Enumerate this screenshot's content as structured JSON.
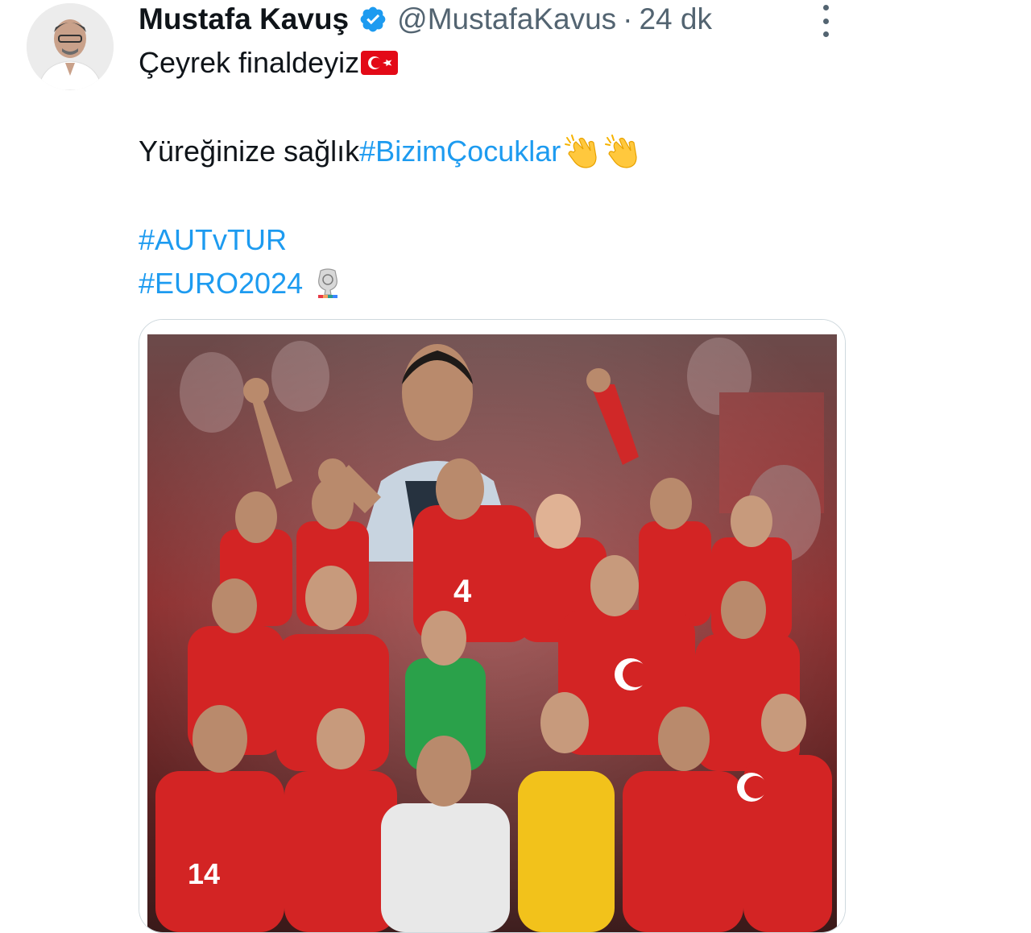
{
  "tweet": {
    "author": {
      "name": "Mustafa Kavuş",
      "handle": "@MustafaKavus",
      "verified": true,
      "avatar": "avatar-photo"
    },
    "separator": "·",
    "time": "24 dk",
    "more_icon": "more-dots-icon",
    "text": {
      "line1": "Çeyrek finaldeyiz",
      "line1_emoji": "turkey-flag-emoji",
      "line2_text": "Yüreğinize sağlık ",
      "line2_hashtag": "#BizimÇocuklar",
      "line2_emoji": "clapping-hands-emoji",
      "line3_hashtag": "#AUTvTUR",
      "line4_hashtag": "#EURO2024",
      "line4_emoji": "euro2024-trophy-emoji"
    },
    "media": {
      "kind": "image",
      "description_icon": "team-poster-image"
    }
  },
  "colors": {
    "text": "#0f1419",
    "secondary": "#536471",
    "link": "#1d9bf0",
    "verified": "#1d9bf0",
    "flag_red": "#e30a17"
  }
}
